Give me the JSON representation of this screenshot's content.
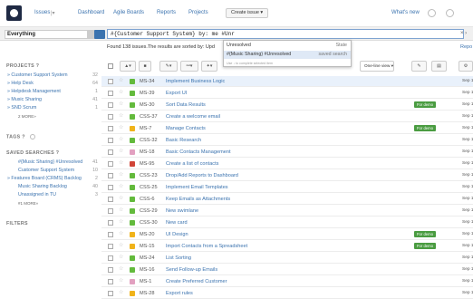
{
  "nav": {
    "issues": "Issues",
    "dashboard": "Dashboard",
    "agile": "Agile Boards",
    "reports": "Reports",
    "projects": "Projects",
    "create": "Create issue",
    "whats_new": "What's new"
  },
  "filter": {
    "selected": "Everything",
    "query": "#{Customer Support System} by: me #Unr"
  },
  "results": {
    "found_text": "Found 138 issues.The results are sorted by: Upd",
    "report_label": "Repo"
  },
  "autocomplete": {
    "rows": [
      {
        "label": "Unresolved",
        "sub": "State"
      },
      {
        "label": "#{Music Sharing} #Unresolved",
        "sub": "saved search"
      }
    ],
    "hint": "Use ↓ to complete selected item"
  },
  "sidebar": {
    "projects_title": "PROJECTS",
    "projects": [
      {
        "label": "Customer Support System",
        "count": "32"
      },
      {
        "label": "Help Desk",
        "count": "64"
      },
      {
        "label": "Helpdesk Management",
        "count": "1"
      },
      {
        "label": "Music Sharing",
        "count": "41"
      },
      {
        "label": "SND Scrum",
        "count": "1"
      }
    ],
    "projects_more": "2 MORE»",
    "tags_title": "TAGS",
    "saved_title": "SAVED SEARCHES",
    "saved": [
      {
        "label": "#{Music Sharing} #Unresolved",
        "count": "41"
      },
      {
        "label": "Customer Support System",
        "count": "10"
      },
      {
        "label": "Features Board (CRMS) Backlog",
        "count": "2"
      },
      {
        "label": "Music Sharing Backlog",
        "count": "40"
      },
      {
        "label": "Unassigned in TU",
        "count": "3"
      }
    ],
    "saved_more": "#1 MORE»",
    "filters_title": "FILTERS"
  },
  "toolbar": {
    "view_label": "One-line view"
  },
  "issues": [
    {
      "key": "MS-34",
      "summary": "Implement Business Logic",
      "type": "t-story",
      "label": "",
      "date": "Sep 1"
    },
    {
      "key": "MS-39",
      "summary": "Export UI",
      "type": "t-story",
      "label": "",
      "date": "Sep 1"
    },
    {
      "key": "MS-30",
      "summary": "Sort Data Results",
      "type": "t-story",
      "label": "For demo",
      "date": "Sep 1"
    },
    {
      "key": "CSS-37",
      "summary": "Create a welcome email",
      "type": "t-story",
      "label": "",
      "date": "Sep 1"
    },
    {
      "key": "MS-7",
      "summary": "Manage Contacts",
      "type": "t-improve",
      "label": "For demo",
      "date": "Sep 1"
    },
    {
      "key": "CSS-32",
      "summary": "Basic Research",
      "type": "t-story",
      "label": "",
      "date": "Sep 1"
    },
    {
      "key": "MS-18",
      "summary": "Basic Contacts Management",
      "type": "t-sub",
      "label": "",
      "date": "Sep 1"
    },
    {
      "key": "MS-95",
      "summary": "Create a list of contacts",
      "type": "t-bug",
      "label": "",
      "date": "Sep 1"
    },
    {
      "key": "CSS-23",
      "summary": "Drop/Add Reports to Dashboard",
      "type": "t-story",
      "label": "",
      "date": "Sep 1"
    },
    {
      "key": "CSS-25",
      "summary": "Implement Email Templates",
      "type": "t-story",
      "label": "",
      "date": "Sep 1"
    },
    {
      "key": "CSS-6",
      "summary": "Keep Emails as Attachments",
      "type": "t-story",
      "label": "",
      "date": "Sep 1"
    },
    {
      "key": "CSS-29",
      "summary": "New swimlane",
      "type": "t-story",
      "label": "",
      "date": "Sep 1"
    },
    {
      "key": "CSS-30",
      "summary": "New card",
      "type": "t-story",
      "label": "",
      "date": "Sep 1"
    },
    {
      "key": "MS-20",
      "summary": "UI Design",
      "type": "t-improve",
      "label": "For demo",
      "date": "Sep 1"
    },
    {
      "key": "MS-15",
      "summary": "Import Contacts from a Spreadsheet",
      "type": "t-improve",
      "label": "For demo",
      "date": "Sep 1"
    },
    {
      "key": "MS-24",
      "summary": "List Sorting",
      "type": "t-story",
      "label": "",
      "date": "Sep 1"
    },
    {
      "key": "MS-16",
      "summary": "Send Follow-up Emails",
      "type": "t-story",
      "label": "",
      "date": "Sep 1"
    },
    {
      "key": "MS-1",
      "summary": "Create Preferred Customer",
      "type": "t-sub",
      "label": "",
      "date": "Sep 1"
    },
    {
      "key": "MS-28",
      "summary": "Export rules",
      "type": "t-improve",
      "label": "",
      "date": "Sep 1"
    }
  ]
}
